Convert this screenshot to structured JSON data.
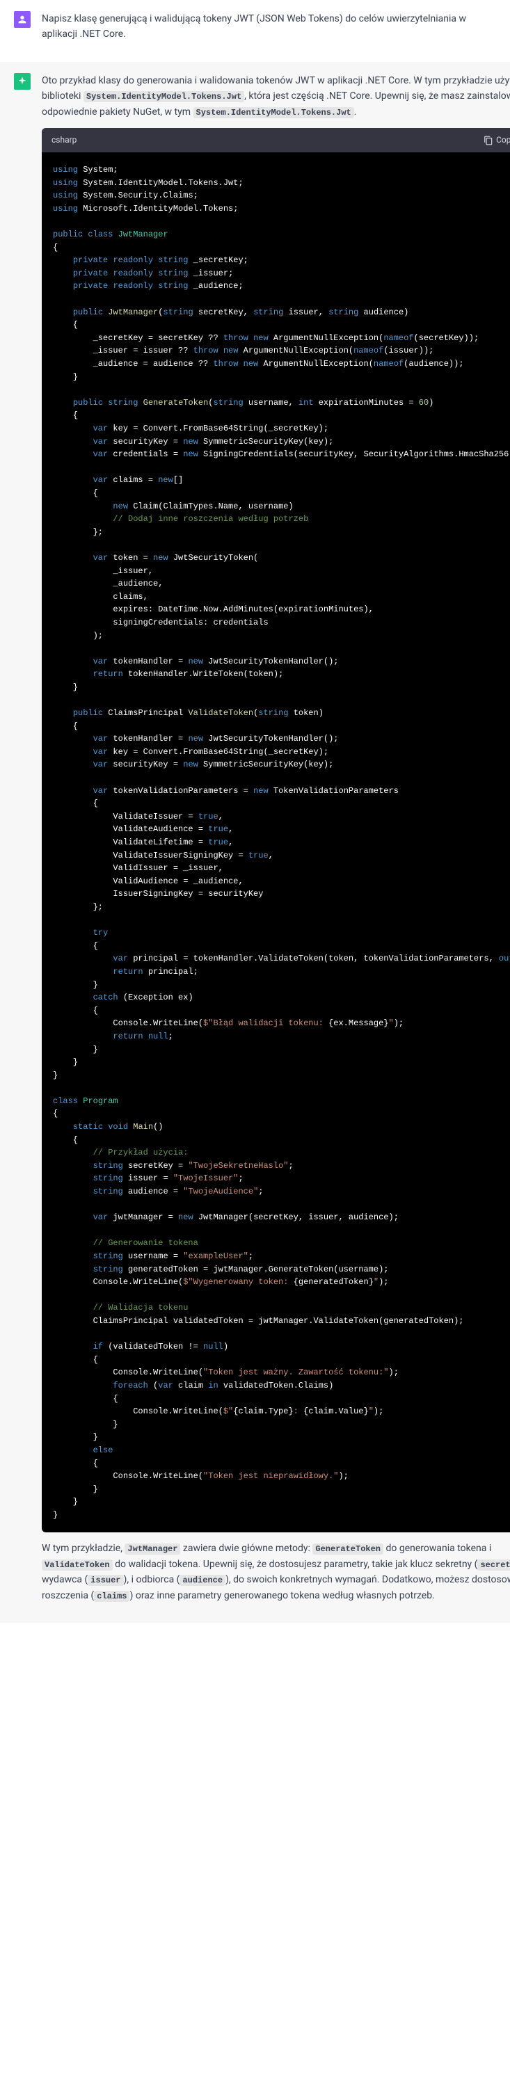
{
  "user": {
    "prompt": "Napisz klasę generującą i walidującą tokeny JWT (JSON Web Tokens) do celów uwierzytelniania w aplikacji .NET Core."
  },
  "assistant": {
    "intro_prefix": "Oto przykład klasy do generowania i walidowania tokenów JWT w aplikacji .NET Core. W tym przykładzie używam biblioteki ",
    "intro_code1": "System.IdentityModel.Tokens.Jwt",
    "intro_mid": ", która jest częścią .NET Core. Upewnij się, że masz zainstalowane odpowiednie pakiety NuGet, w tym ",
    "intro_code2": "System.IdentityModel.Tokens.Jwt",
    "intro_end": ".",
    "lang": "csharp",
    "copy": "Copy code",
    "outro_p1": "W tym przykładzie, ",
    "outro_c1": "JwtManager",
    "outro_p2": " zawiera dwie główne metody: ",
    "outro_c2": "GenerateToken",
    "outro_p3": " do generowania tokena i ",
    "outro_c3": "ValidateToken",
    "outro_p4": " do walidacji tokena. Upewnij się, że dostosujesz parametry, takie jak klucz sekretny (",
    "outro_c4": "secretKey",
    "outro_p5": "), wydawca (",
    "outro_c5": "issuer",
    "outro_p6": "), i odbiorca (",
    "outro_c6": "audience",
    "outro_p7": "), do swoich konkretnych wymagań. Dodatkowo, możesz dostosować roszczenia (",
    "outro_c7": "claims",
    "outro_p8": ") oraz inne parametry generowanego tokena według własnych potrzeb."
  }
}
